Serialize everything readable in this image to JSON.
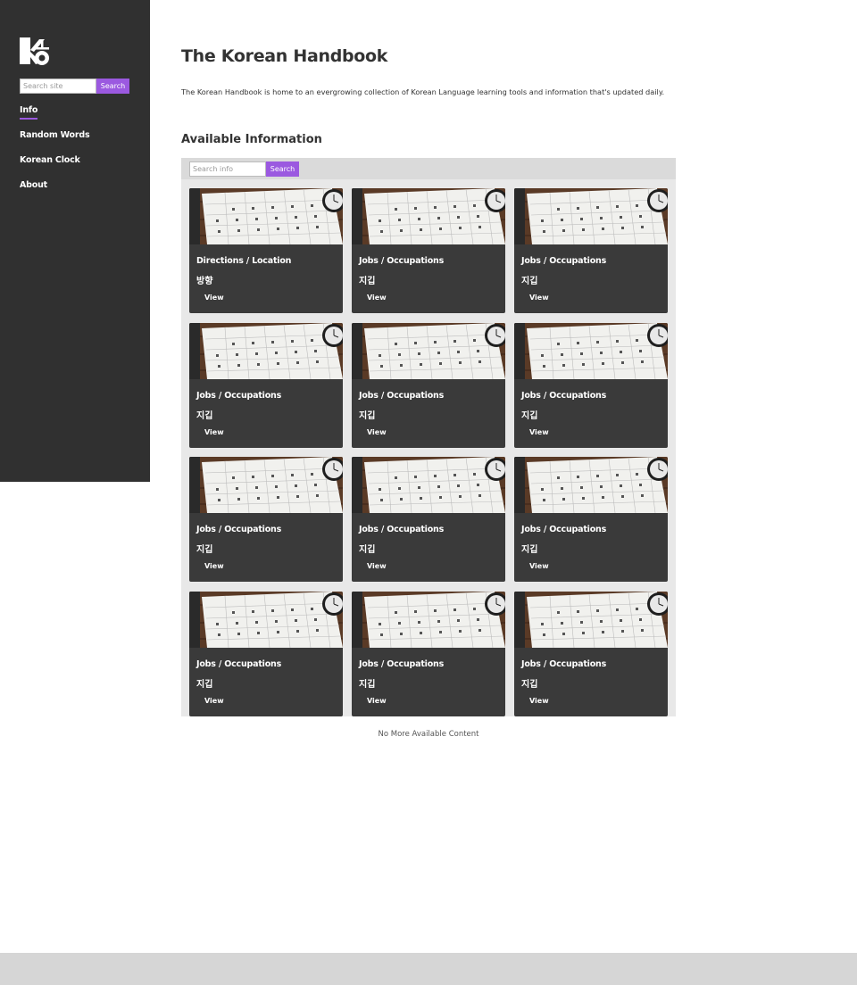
{
  "sidebar": {
    "logo_icon": "korean-letter-logo-icon",
    "search": {
      "placeholder": "Search site",
      "button_label": "Search"
    },
    "nav": [
      {
        "label": "Info",
        "active": true
      },
      {
        "label": "Random Words",
        "active": false
      },
      {
        "label": "Korean Clock",
        "active": false
      },
      {
        "label": "About",
        "active": false
      }
    ]
  },
  "main": {
    "title": "The Korean Handbook",
    "intro": "The Korean Handbook is home to an evergrowing collection of Korean Language learning tools and information that's updated daily.",
    "section_title": "Available Information",
    "info_search": {
      "placeholder": "Search info",
      "button_label": "Search"
    },
    "cards": [
      {
        "category": "Directions / Location",
        "korean": "방향",
        "link": "View"
      },
      {
        "category": "Jobs / Occupations",
        "korean": "지깁",
        "link": "View"
      },
      {
        "category": "Jobs / Occupations",
        "korean": "지깁",
        "link": "View"
      },
      {
        "category": "Jobs / Occupations",
        "korean": "지깁",
        "link": "View"
      },
      {
        "category": "Jobs / Occupations",
        "korean": "지깁",
        "link": "View"
      },
      {
        "category": "Jobs / Occupations",
        "korean": "지깁",
        "link": "View"
      },
      {
        "category": "Jobs / Occupations",
        "korean": "지깁",
        "link": "View"
      },
      {
        "category": "Jobs / Occupations",
        "korean": "지깁",
        "link": "View"
      },
      {
        "category": "Jobs / Occupations",
        "korean": "지깁",
        "link": "View"
      },
      {
        "category": "Jobs / Occupations",
        "korean": "지깁",
        "link": "View"
      },
      {
        "category": "Jobs / Occupations",
        "korean": "지깁",
        "link": "View"
      },
      {
        "category": "Jobs / Occupations",
        "korean": "지깁",
        "link": "View"
      }
    ],
    "end_message": "No More Available Content"
  },
  "colors": {
    "sidebar_bg": "#303030",
    "accent": "#9b59e0",
    "card_bg": "#3a3a3a",
    "panel_bg": "#e8e8e8",
    "footer_bg": "#d6d6d6"
  }
}
